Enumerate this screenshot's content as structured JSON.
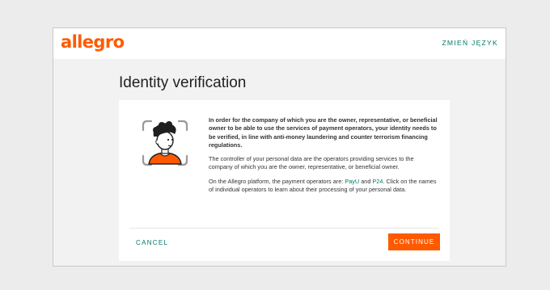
{
  "header": {
    "logo_text": "allegro",
    "language_switch": "ZMIEŃ JĘZYK"
  },
  "page": {
    "title": "Identity verification"
  },
  "content": {
    "lead": "In order for the company of which you are the owner, representative, or beneficial owner to be able to use the services of payment operators, your identity needs to be verified, in line with anti-money laundering and counter terrorism financing regulations.",
    "controller": "The controller of your personal data are the operators providing services to the company of which you are the owner, representative, or beneficial owner.",
    "operators_prefix": "On the Allegro platform, the payment operators are: ",
    "operator_1": "PayU",
    "operators_and": " and ",
    "operator_2": "P24",
    "operators_suffix": ". Click on the names of individual operators to learn about their processing of your personal data."
  },
  "actions": {
    "cancel_label": "CANCEL",
    "continue_label": "CONTINUE"
  },
  "colors": {
    "brand": "#ff5a00",
    "link": "#00796b"
  },
  "icons": {
    "illustration": "face-scan-illustration"
  }
}
